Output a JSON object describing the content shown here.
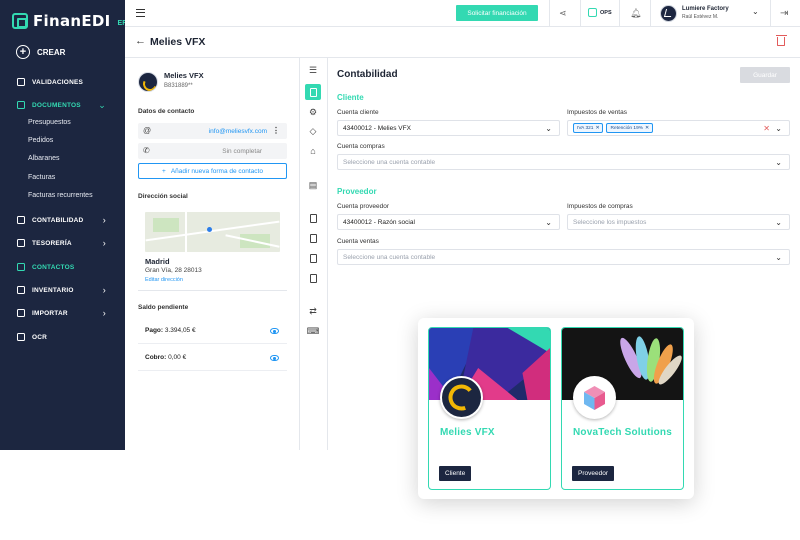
{
  "brand": {
    "name": "FinanEDI",
    "sub": "ERP",
    "accent": "#33d9b2",
    "sidebar_bg": "#1c2640"
  },
  "sidebar": {
    "create_label": "CREAR",
    "items": [
      {
        "label": "VALIDACIONES",
        "icon": "validation-icon"
      },
      {
        "label": "DOCUMENTOS",
        "icon": "documents-icon",
        "active": true
      },
      {
        "label": "CONTABILIDAD",
        "icon": "accounting-icon"
      },
      {
        "label": "TESORERÍA",
        "icon": "treasury-icon"
      },
      {
        "label": "CONTACTOS",
        "icon": "contacts-icon",
        "active": true
      },
      {
        "label": "INVENTARIO",
        "icon": "inventory-icon"
      },
      {
        "label": "IMPORTAR",
        "icon": "import-icon"
      },
      {
        "label": "OCR",
        "icon": "ocr-icon"
      }
    ],
    "subitems": [
      "Presupuestos",
      "Pedidos",
      "Albaranes",
      "Facturas",
      "Facturas recurrentes"
    ]
  },
  "topbar": {
    "financing_label": "Solicitar financiación",
    "ops_label": "OPS",
    "company_name": "Lumiere Factory",
    "company_user": "Raúl Estévez M."
  },
  "header": {
    "title": "Melies VFX"
  },
  "contact": {
    "name": "Melies VFX",
    "cif": "B831889**",
    "contact_section": "Datos de contacto",
    "email": "info@meliesvfx.com",
    "phone_placeholder": "Sin completar",
    "add_contact_label": "Añadir nueva forma de contacto",
    "address_section": "Dirección social",
    "city": "Madrid",
    "street": "Gran Vía, 28  28013",
    "edit_address": "Editar dirección",
    "balance_section": "Saldo pendiente",
    "pago_label": "Pago:",
    "pago_value": "3.394,05 €",
    "cobro_label": "Cobro:",
    "cobro_value": "0,00 €"
  },
  "main": {
    "title": "Contabilidad",
    "save_label": "Guardar",
    "cliente_section": "Cliente",
    "cuenta_cliente_label": "Cuenta cliente",
    "cuenta_cliente_value": "43400012 - Melies VFX",
    "impuestos_ventas_label": "Impuestos de ventas",
    "impuestos_ventas_tags": [
      "IVA 321",
      "Retención 19%"
    ],
    "cuenta_compras_label": "Cuenta compras",
    "cuenta_placeholder": "Seleccione una cuenta contable",
    "proveedor_section": "Proveedor",
    "cuenta_proveedor_label": "Cuenta  proveedor",
    "cuenta_proveedor_value": "43400012 - Razón social",
    "impuestos_compras_label": "Impuestos de compras",
    "impuestos_placeholder": "Seleccione los impuestos",
    "cuenta_ventas_label": "Cuenta ventas"
  },
  "cards": [
    {
      "name": "Melies VFX",
      "type": "Cliente"
    },
    {
      "name": "NovaTech Solutions",
      "type": "Proveedor"
    }
  ]
}
